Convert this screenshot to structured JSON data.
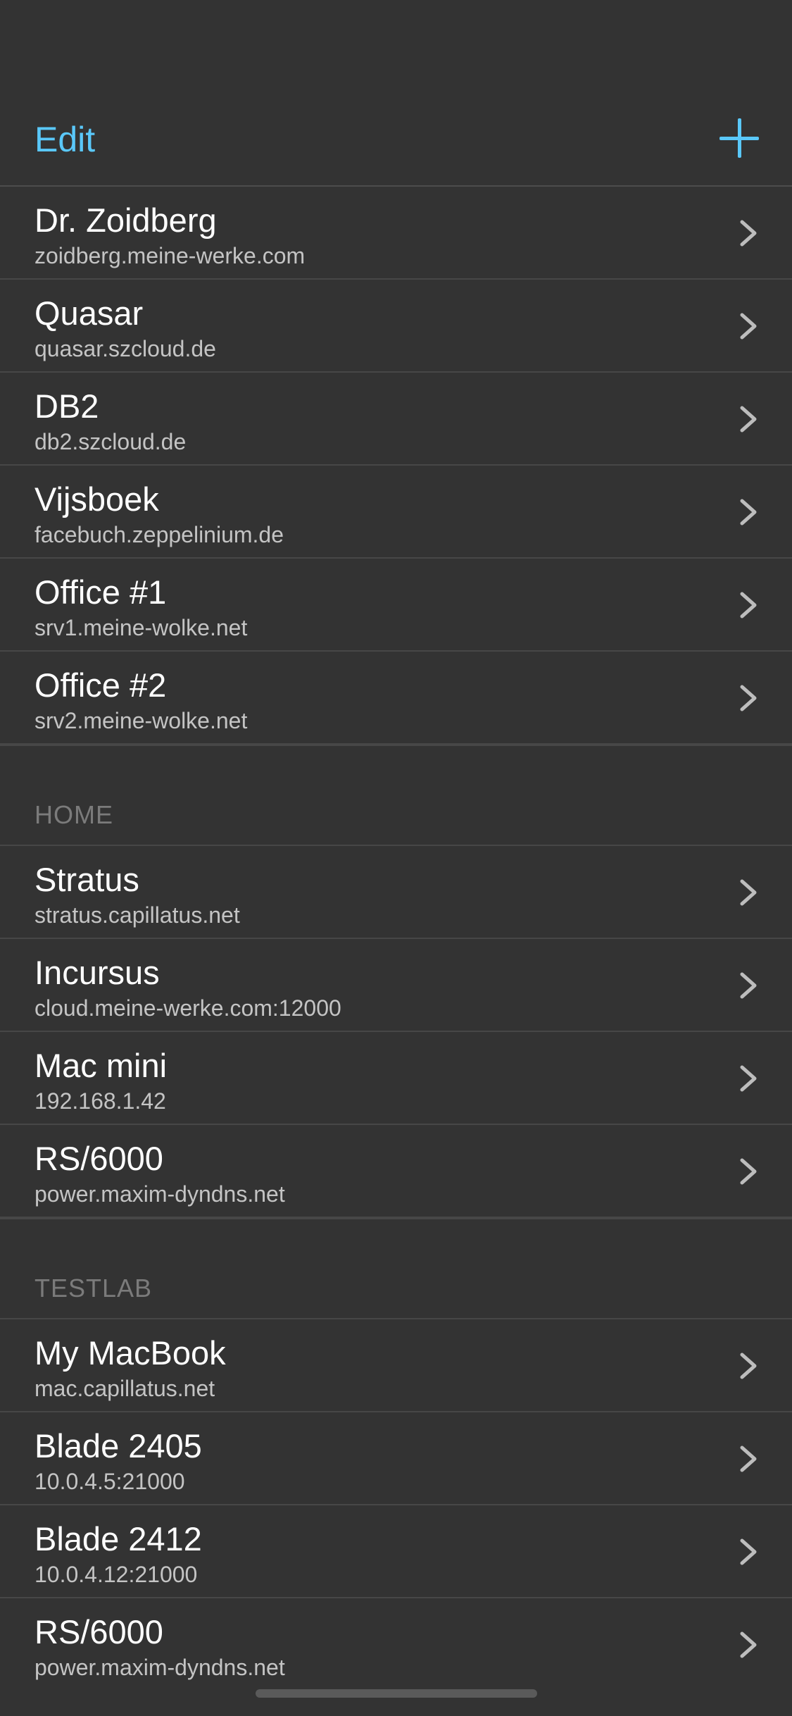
{
  "nav": {
    "edit_label": "Edit",
    "add_icon": "plus-icon",
    "accent_color": "#5ac8fa"
  },
  "groups": [
    {
      "header": "",
      "items": [
        {
          "title": "Dr. Zoidberg",
          "subtitle": "zoidberg.meine-werke.com"
        },
        {
          "title": "Quasar",
          "subtitle": "quasar.szcloud.de"
        },
        {
          "title": "DB2",
          "subtitle": "db2.szcloud.de"
        },
        {
          "title": "Vijsboek",
          "subtitle": "facebuch.zeppelinium.de"
        },
        {
          "title": "Office #1",
          "subtitle": "srv1.meine-wolke.net"
        },
        {
          "title": "Office #2",
          "subtitle": "srv2.meine-wolke.net"
        }
      ]
    },
    {
      "header": "HOME",
      "items": [
        {
          "title": "Stratus",
          "subtitle": "stratus.capillatus.net"
        },
        {
          "title": "Incursus",
          "subtitle": "cloud.meine-werke.com:12000"
        },
        {
          "title": "Mac mini",
          "subtitle": "192.168.1.42"
        },
        {
          "title": "RS/6000",
          "subtitle": "power.maxim-dyndns.net"
        }
      ]
    },
    {
      "header": "TESTLAB",
      "items": [
        {
          "title": "My MacBook",
          "subtitle": "mac.capillatus.net"
        },
        {
          "title": "Blade 2405",
          "subtitle": "10.0.4.5:21000"
        },
        {
          "title": "Blade 2412",
          "subtitle": "10.0.4.12:21000"
        },
        {
          "title": "RS/6000",
          "subtitle": "power.maxim-dyndns.net"
        }
      ]
    }
  ]
}
